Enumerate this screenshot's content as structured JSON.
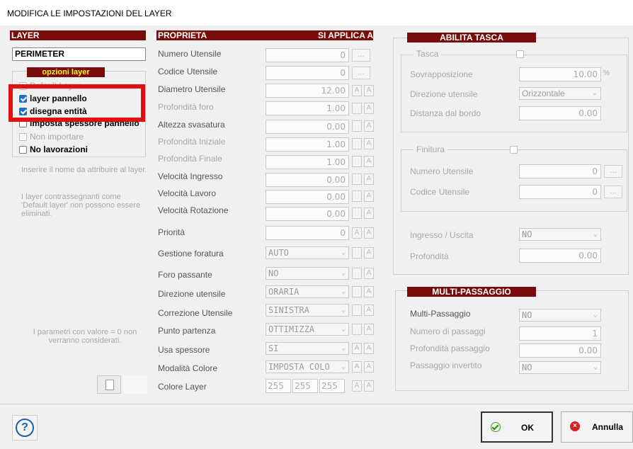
{
  "window": {
    "title": "MODIFICA LE IMPOSTAZIONI DEL LAYER"
  },
  "headers": {
    "layer": "LAYER",
    "proprieta": "PROPRIETA",
    "applica": "SI APPLICA A",
    "abilita_tasca": "ABILITA TASCA",
    "multi": "MULTI-PASSAGGIO"
  },
  "layer": {
    "name": "PERIMETER",
    "options_title": "opzioni layer",
    "options": [
      {
        "label": "Default Layer",
        "checked": false,
        "enabled": false
      },
      {
        "label": "layer pannello",
        "checked": true,
        "enabled": true
      },
      {
        "label": "disegna entità",
        "checked": true,
        "enabled": true
      },
      {
        "label": "imposta spessore pannello",
        "checked": false,
        "enabled": true
      },
      {
        "label": "Non importare",
        "checked": false,
        "enabled": false
      },
      {
        "label": "No lavorazioni",
        "checked": false,
        "enabled": true
      }
    ],
    "help1": "Inserire il nome da attribuire al layer.",
    "help2": "I layer contrassegnanti come 'Default layer' non possono essere eliminati.",
    "help3": "I parametri con valore = 0 non verranno considerati."
  },
  "props": [
    {
      "label": "Numero Utensile",
      "value": "0",
      "extra": "..."
    },
    {
      "label": "Codice Utensile",
      "value": "0",
      "extra": "..."
    },
    {
      "label": "Diametro Utensile",
      "value": "12.00"
    },
    {
      "label": "Profondità foro",
      "value": "1.00"
    },
    {
      "label": "Altezza svasatura",
      "value": "0.00"
    },
    {
      "label": "Profondità Iniziale",
      "value": "1.00"
    },
    {
      "label": "Profondità Finale",
      "value": "1.00"
    },
    {
      "label": "Velocità Ingresso",
      "value": "0.00"
    },
    {
      "label": "Velocità Lavoro",
      "value": "0.00"
    },
    {
      "label": "Velocità Rotazione",
      "value": "0.00"
    },
    {
      "label": "Priorità",
      "value": "0"
    },
    {
      "label": "Gestione foratura",
      "value": "AUTO"
    },
    {
      "label": "Foro passante",
      "value": "NO"
    },
    {
      "label": "Direzione utensile",
      "value": "ORARIA"
    },
    {
      "label": "Correzione Utensile",
      "value": "SINISTRA"
    },
    {
      "label": "Punto partenza",
      "value": "OTTIMIZZA"
    },
    {
      "label": "Usa spessore",
      "value": "SI"
    },
    {
      "label": "Modalità Colore",
      "value": "IMPOSTA COLO"
    },
    {
      "label": "Colore Layer",
      "r": "255",
      "g": "255",
      "b": "255"
    }
  ],
  "apply_letter": "A",
  "tasca": {
    "title": "Tasca",
    "sovrapposizione_label": "Sovrapposizione",
    "sovrapposizione_value": "10.00",
    "sovrapposizione_unit": "%",
    "direzione_label": "Direzione utensile",
    "direzione_value": "Orizzontale",
    "distanza_label": "Distanza dal bordo",
    "distanza_value": "0.00"
  },
  "finitura": {
    "title": "Finitura",
    "numero_label": "Numero Utensile",
    "numero_value": "0",
    "codice_label": "Codice Utensile",
    "codice_value": "0",
    "extra": "...",
    "ingresso_label": "Ingresso / Uscita",
    "ingresso_value": "NO",
    "profondita_label": "Profondità",
    "profondita_value": "0.00"
  },
  "multi": {
    "mp_label": "Multi-Passaggio",
    "mp_value": "NO",
    "num_label": "Numero di passaggi",
    "num_value": "1",
    "prof_label": "Profondità passaggio",
    "prof_value": "0.00",
    "inv_label": "Passaggio invertito",
    "inv_value": "NO"
  },
  "buttons": {
    "ok": "OK",
    "cancel": "Annulla",
    "help": "?"
  },
  "colors": {
    "header": "#7a0b0b",
    "highlight_box": "#e01010",
    "check": "#1f6fd0"
  }
}
